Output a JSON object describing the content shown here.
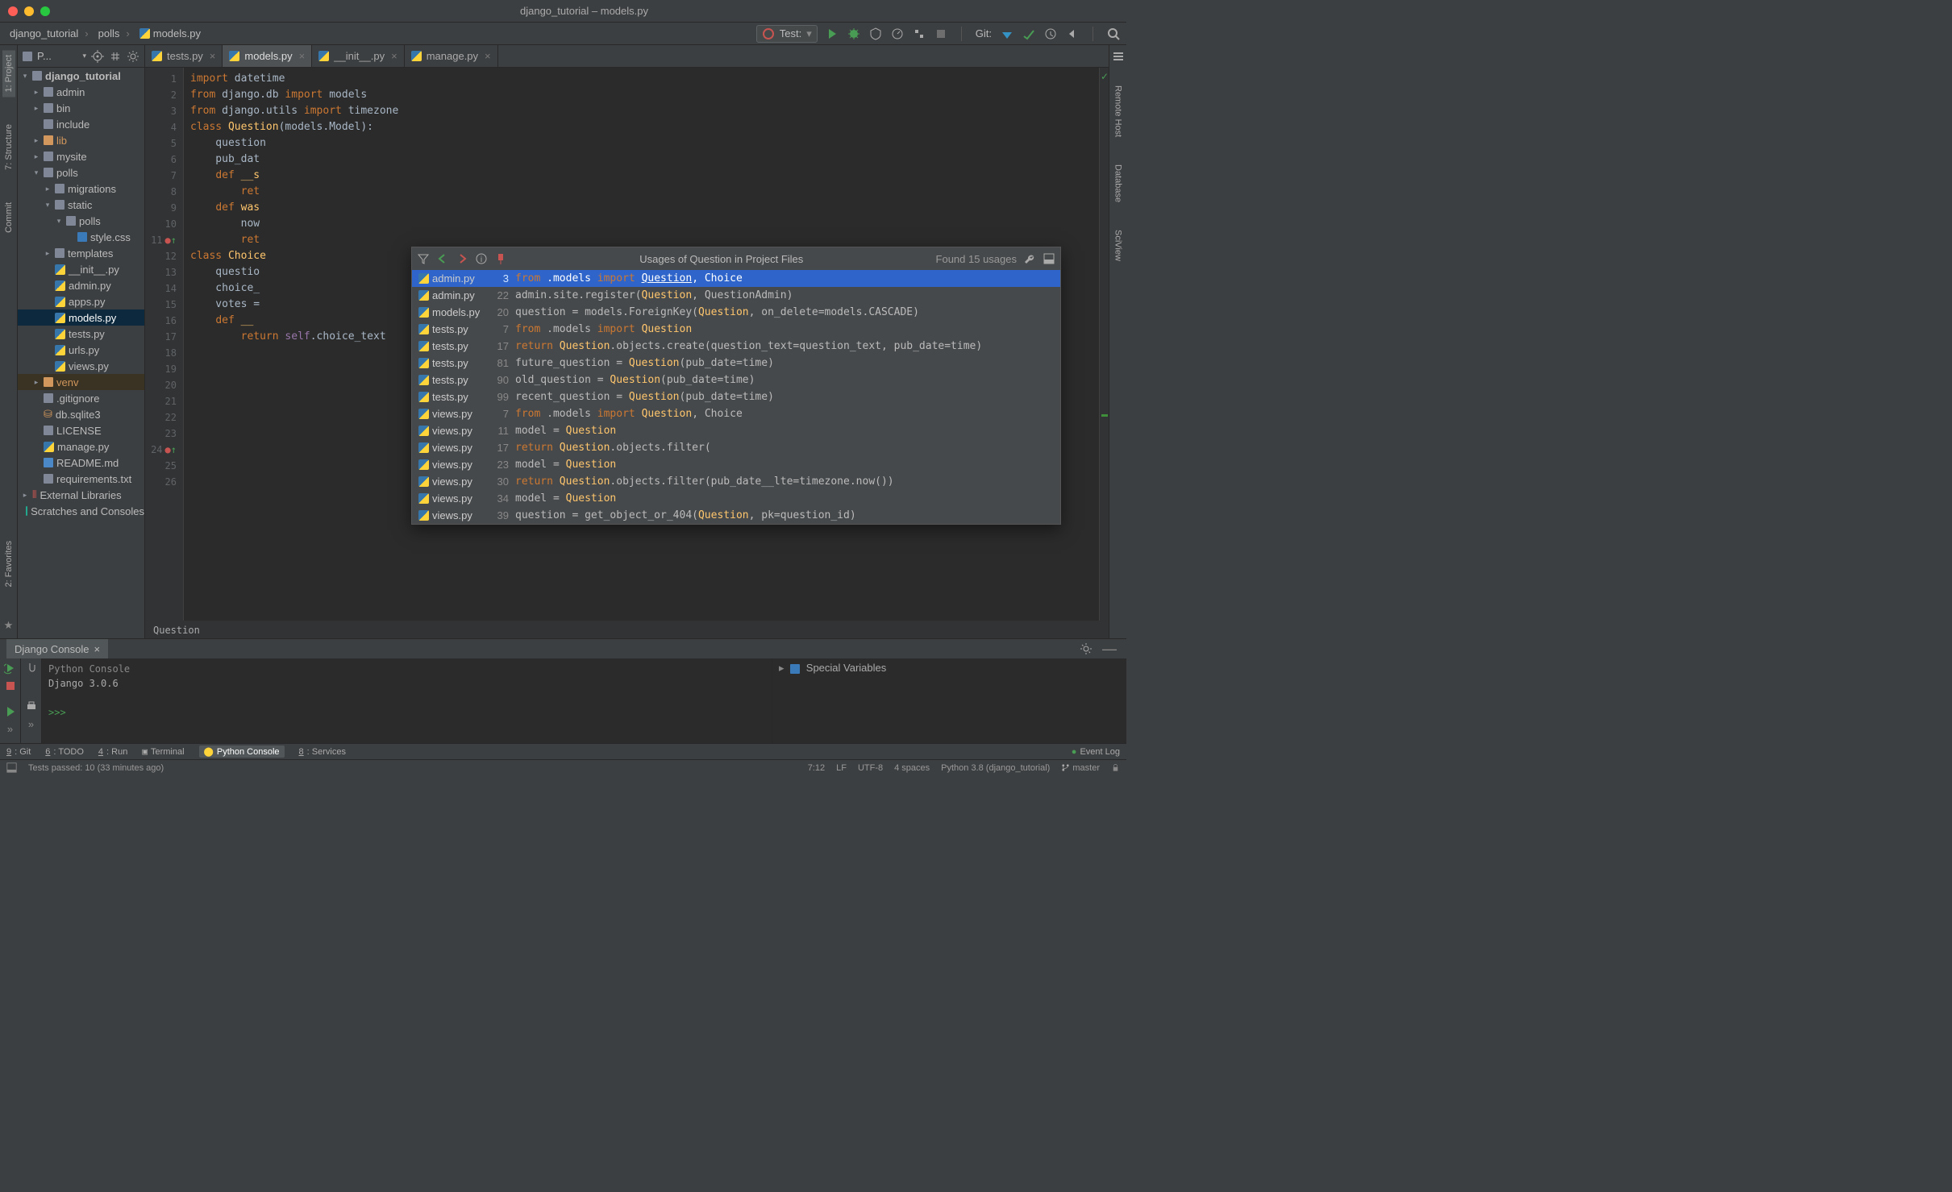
{
  "window_title": "django_tutorial – models.py",
  "crumbs": [
    "django_tutorial",
    "polls",
    "models.py"
  ],
  "run_config": "Test:",
  "git_label": "Git:",
  "project": {
    "header": "P...",
    "tree": [
      {
        "d": 0,
        "open": true,
        "kind": "dir",
        "label": "django_tutorial",
        "bold": true
      },
      {
        "d": 1,
        "open": false,
        "kind": "dir",
        "label": "admin"
      },
      {
        "d": 1,
        "open": false,
        "kind": "dir",
        "label": "bin"
      },
      {
        "d": 1,
        "open": false,
        "kind": "dir",
        "label": "include",
        "noarrow": true
      },
      {
        "d": 1,
        "open": false,
        "kind": "dir",
        "label": "lib",
        "hl": true
      },
      {
        "d": 1,
        "open": false,
        "kind": "dir",
        "label": "mysite"
      },
      {
        "d": 1,
        "open": true,
        "kind": "dir",
        "label": "polls"
      },
      {
        "d": 2,
        "open": false,
        "kind": "dir",
        "label": "migrations"
      },
      {
        "d": 2,
        "open": true,
        "kind": "dir",
        "label": "static"
      },
      {
        "d": 3,
        "open": true,
        "kind": "dir",
        "label": "polls"
      },
      {
        "d": 4,
        "open": false,
        "kind": "css",
        "label": "style.css",
        "noarrow": true
      },
      {
        "d": 2,
        "open": false,
        "kind": "dir",
        "label": "templates"
      },
      {
        "d": 2,
        "kind": "py",
        "label": "__init__.py",
        "noarrow": true
      },
      {
        "d": 2,
        "kind": "py",
        "label": "admin.py",
        "noarrow": true
      },
      {
        "d": 2,
        "kind": "py",
        "label": "apps.py",
        "noarrow": true
      },
      {
        "d": 2,
        "kind": "py",
        "label": "models.py",
        "sel": true,
        "noarrow": true
      },
      {
        "d": 2,
        "kind": "py",
        "label": "tests.py",
        "noarrow": true
      },
      {
        "d": 2,
        "kind": "py",
        "label": "urls.py",
        "noarrow": true
      },
      {
        "d": 2,
        "kind": "py",
        "label": "views.py",
        "noarrow": true
      },
      {
        "d": 1,
        "open": false,
        "kind": "dir",
        "label": "venv",
        "hl": true,
        "bgsel": true
      },
      {
        "d": 1,
        "kind": "txt",
        "label": ".gitignore",
        "noarrow": true
      },
      {
        "d": 1,
        "kind": "db",
        "label": "db.sqlite3",
        "noarrow": true
      },
      {
        "d": 1,
        "kind": "txt",
        "label": "LICENSE",
        "noarrow": true
      },
      {
        "d": 1,
        "kind": "py",
        "label": "manage.py",
        "noarrow": true
      },
      {
        "d": 1,
        "kind": "md",
        "label": "README.md",
        "noarrow": true
      },
      {
        "d": 1,
        "kind": "txt",
        "label": "requirements.txt",
        "noarrow": true
      },
      {
        "d": 0,
        "open": false,
        "kind": "lib",
        "label": "External Libraries"
      },
      {
        "d": 0,
        "kind": "scratch",
        "label": "Scratches and Consoles",
        "noarrow": true
      }
    ]
  },
  "tabs": [
    {
      "label": "tests.py",
      "active": false
    },
    {
      "label": "models.py",
      "active": true
    },
    {
      "label": "__init__.py",
      "active": false
    },
    {
      "label": "manage.py",
      "active": false
    }
  ],
  "code_crumb": "Question",
  "lines": [
    {
      "n": 1,
      "seg": [
        [
          "kw",
          "import "
        ],
        [
          "",
          "datetime"
        ]
      ]
    },
    {
      "n": 2,
      "seg": [
        [
          "",
          ""
        ]
      ]
    },
    {
      "n": 3,
      "seg": [
        [
          "kw",
          "from "
        ],
        [
          "",
          "django.db "
        ],
        [
          "kw",
          "import "
        ],
        [
          "",
          "models"
        ]
      ]
    },
    {
      "n": 4,
      "seg": [
        [
          "kw",
          "from "
        ],
        [
          "",
          "django.utils "
        ],
        [
          "kw",
          "import "
        ],
        [
          "",
          "timezone"
        ]
      ]
    },
    {
      "n": 5,
      "seg": [
        [
          "",
          ""
        ]
      ]
    },
    {
      "n": 6,
      "seg": [
        [
          "",
          ""
        ]
      ]
    },
    {
      "n": 7,
      "seg": [
        [
          "kw",
          "class "
        ],
        [
          "fn",
          "Question"
        ],
        [
          "",
          "(models.Model):"
        ]
      ]
    },
    {
      "n": 8,
      "seg": [
        [
          "",
          "    question"
        ]
      ]
    },
    {
      "n": 9,
      "seg": [
        [
          "",
          "    pub_dat"
        ]
      ]
    },
    {
      "n": 10,
      "seg": [
        [
          "",
          ""
        ]
      ]
    },
    {
      "n": 11,
      "seg": [
        [
          "",
          "    "
        ],
        [
          "kw",
          "def "
        ],
        [
          "fn",
          "__s"
        ]
      ]
    },
    {
      "n": 12,
      "seg": [
        [
          "",
          "        "
        ],
        [
          "kw",
          "ret"
        ]
      ]
    },
    {
      "n": 13,
      "seg": [
        [
          "",
          ""
        ]
      ]
    },
    {
      "n": 14,
      "seg": [
        [
          "",
          "    "
        ],
        [
          "kw",
          "def "
        ],
        [
          "fn",
          "was"
        ]
      ]
    },
    {
      "n": 15,
      "seg": [
        [
          "",
          "        now"
        ]
      ]
    },
    {
      "n": 16,
      "seg": [
        [
          "",
          "        "
        ],
        [
          "kw",
          "ret"
        ]
      ]
    },
    {
      "n": 17,
      "seg": [
        [
          "",
          ""
        ]
      ]
    },
    {
      "n": 18,
      "seg": [
        [
          "",
          ""
        ]
      ]
    },
    {
      "n": 19,
      "seg": [
        [
          "kw",
          "class "
        ],
        [
          "fn",
          "Choice"
        ]
      ]
    },
    {
      "n": 20,
      "seg": [
        [
          "",
          "    questio"
        ]
      ]
    },
    {
      "n": 21,
      "seg": [
        [
          "",
          "    choice_"
        ]
      ]
    },
    {
      "n": 22,
      "seg": [
        [
          "",
          "    votes ="
        ]
      ]
    },
    {
      "n": 23,
      "seg": [
        [
          "",
          ""
        ]
      ]
    },
    {
      "n": 24,
      "seg": [
        [
          "",
          "    "
        ],
        [
          "kw",
          "def "
        ],
        [
          "fn",
          "__"
        ]
      ]
    },
    {
      "n": 25,
      "seg": [
        [
          "",
          "        "
        ],
        [
          "kw",
          "return "
        ],
        [
          "py",
          "self"
        ],
        [
          "",
          ".choice_text"
        ]
      ]
    },
    {
      "n": 26,
      "seg": [
        [
          "",
          ""
        ]
      ]
    }
  ],
  "gutter_marks": [
    {
      "line": 11,
      "icon": "override"
    },
    {
      "line": 24,
      "icon": "override"
    }
  ],
  "popup": {
    "title": "Usages of Question in Project Files",
    "count": "Found 15 usages",
    "rows": [
      {
        "file": "admin.py",
        "line": 3,
        "sel": true,
        "code": [
          [
            "kw",
            "from "
          ],
          [
            "",
            ".models "
          ],
          [
            "kw",
            "import "
          ],
          [
            "hl",
            "Question"
          ],
          [
            "",
            ", Choice"
          ]
        ]
      },
      {
        "file": "admin.py",
        "line": 22,
        "code": [
          [
            "",
            "admin.site.register("
          ],
          [
            "hl",
            "Question"
          ],
          [
            "",
            ", QuestionAdmin)"
          ]
        ]
      },
      {
        "file": "models.py",
        "line": 20,
        "code": [
          [
            "",
            "question = models.ForeignKey("
          ],
          [
            "hl",
            "Question"
          ],
          [
            "",
            ", on_delete=models.CASCADE)"
          ]
        ]
      },
      {
        "file": "tests.py",
        "line": 7,
        "code": [
          [
            "kw",
            "from "
          ],
          [
            "",
            ".models "
          ],
          [
            "kw",
            "import "
          ],
          [
            "hl",
            "Question"
          ]
        ]
      },
      {
        "file": "tests.py",
        "line": 17,
        "code": [
          [
            "kw",
            "return "
          ],
          [
            "hl",
            "Question"
          ],
          [
            "",
            ".objects.create(question_text=question_text, pub_date=time)"
          ]
        ]
      },
      {
        "file": "tests.py",
        "line": 81,
        "code": [
          [
            "",
            "future_question = "
          ],
          [
            "hl",
            "Question"
          ],
          [
            "",
            "(pub_date=time)"
          ]
        ]
      },
      {
        "file": "tests.py",
        "line": 90,
        "code": [
          [
            "",
            "old_question = "
          ],
          [
            "hl",
            "Question"
          ],
          [
            "",
            "(pub_date=time)"
          ]
        ]
      },
      {
        "file": "tests.py",
        "line": 99,
        "code": [
          [
            "",
            "recent_question = "
          ],
          [
            "hl",
            "Question"
          ],
          [
            "",
            "(pub_date=time)"
          ]
        ]
      },
      {
        "file": "views.py",
        "line": 7,
        "code": [
          [
            "kw",
            "from "
          ],
          [
            "",
            ".models "
          ],
          [
            "kw",
            "import "
          ],
          [
            "hl",
            "Question"
          ],
          [
            "",
            ", Choice"
          ]
        ]
      },
      {
        "file": "views.py",
        "line": 11,
        "code": [
          [
            "",
            "model = "
          ],
          [
            "hl",
            "Question"
          ]
        ]
      },
      {
        "file": "views.py",
        "line": 17,
        "code": [
          [
            "kw",
            "return "
          ],
          [
            "hl",
            "Question"
          ],
          [
            "",
            ".objects.filter("
          ]
        ]
      },
      {
        "file": "views.py",
        "line": 23,
        "code": [
          [
            "",
            "model = "
          ],
          [
            "hl",
            "Question"
          ]
        ]
      },
      {
        "file": "views.py",
        "line": 30,
        "code": [
          [
            "kw",
            "return "
          ],
          [
            "hl",
            "Question"
          ],
          [
            "",
            ".objects.filter(pub_date__lte=timezone.now())"
          ]
        ]
      },
      {
        "file": "views.py",
        "line": 34,
        "code": [
          [
            "",
            "model = "
          ],
          [
            "hl",
            "Question"
          ]
        ]
      },
      {
        "file": "views.py",
        "line": 39,
        "code": [
          [
            "",
            "question = get_object_or_404("
          ],
          [
            "hl",
            "Question"
          ],
          [
            "",
            ", pk=question_id)"
          ]
        ]
      }
    ]
  },
  "left_tabs": [
    {
      "label": "1: Project",
      "active": true
    },
    {
      "label": "7: Structure",
      "active": false
    },
    {
      "label": "Commit",
      "active": false
    },
    {
      "label": "2: Favorites",
      "active": false
    }
  ],
  "right_tabs": [
    "Remote Host",
    "Database",
    "SciView"
  ],
  "console": {
    "tab_label": "Django Console",
    "header": "Python Console",
    "version": "Django 3.0.6",
    "prompt": ">>>",
    "vars_label": "Special Variables"
  },
  "tool_windows": [
    {
      "label": "9: Git",
      "key": "9"
    },
    {
      "label": "6: TODO",
      "key": "6"
    },
    {
      "label": "4: Run",
      "key": "4"
    },
    {
      "label": "Terminal"
    },
    {
      "label": "Python Console",
      "active": true
    },
    {
      "label": "8: Services",
      "key": "8"
    }
  ],
  "event_log": "Event Log",
  "status": {
    "left": "Tests passed: 10 (33 minutes ago)",
    "pos": "7:12",
    "le": "LF",
    "enc": "UTF-8",
    "indent": "4 spaces",
    "interp": "Python 3.8 (django_tutorial)",
    "branch": "master"
  }
}
